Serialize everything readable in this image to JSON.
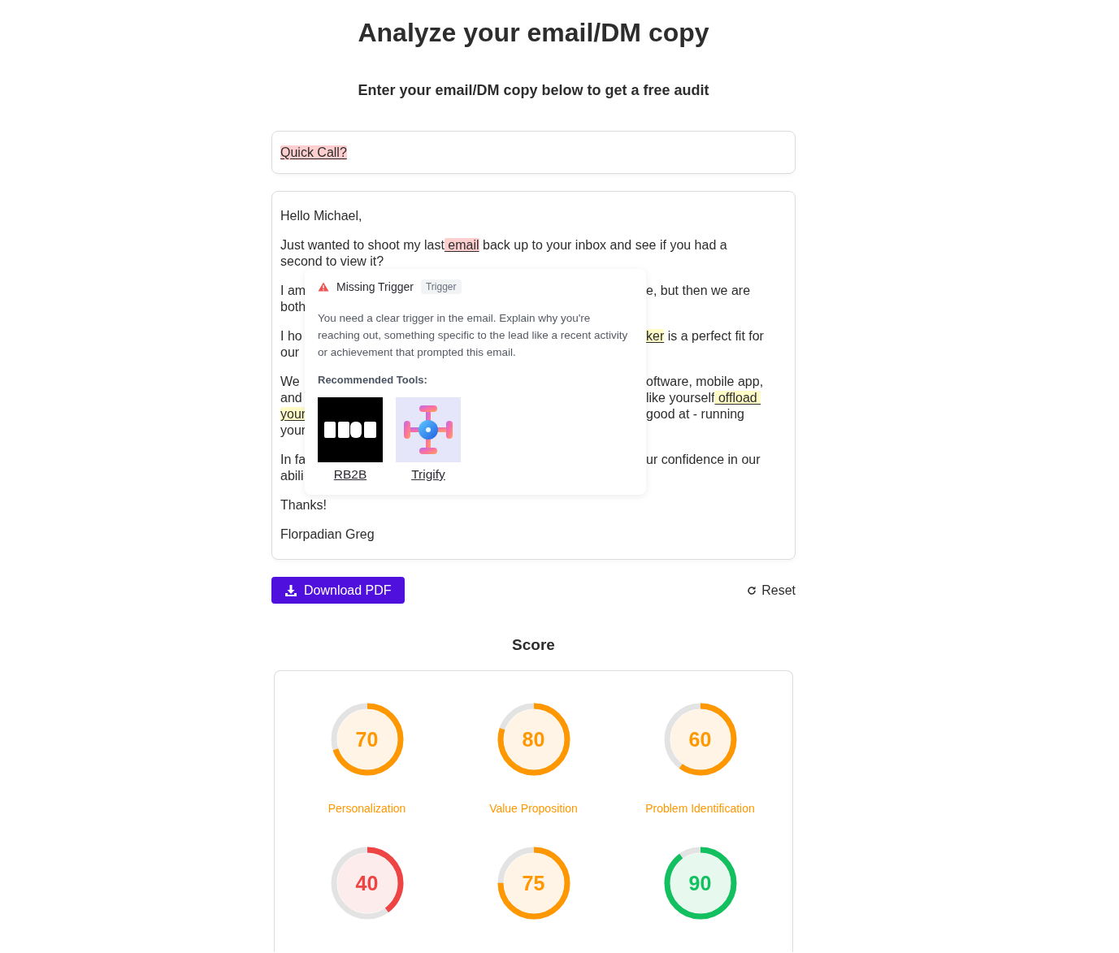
{
  "title": "Analyze your email/DM copy",
  "subtitle": "Enter your email/DM copy below to get a free audit",
  "subject": [
    {
      "text": "Quick Call?",
      "color": "#ffcfcf"
    }
  ],
  "email": {
    "paragraphs": [
      [
        {
          "left": [
            {
              "text": "Hello Michael,"
            }
          ]
        }
      ],
      [
        {
          "left": [
            {
              "text": "Just wanted to shoot my last"
            },
            {
              "text": " email",
              "color": "#ffcfcf"
            },
            {
              "text": " back up to your inbox and see if you had a"
            }
          ]
        },
        {
          "left": [
            {
              "text": "second to view it?"
            }
          ]
        }
      ],
      [
        {
          "left": [
            {
              "text": "I am"
            }
          ],
          "right": [
            {
              "text": "e, but then we are"
            }
          ]
        },
        {
          "left": [
            {
              "text": "both"
            }
          ]
        }
      ],
      [
        {
          "left": [
            {
              "text": "I ho"
            }
          ],
          "right": [
            {
              "text": "ker",
              "color": "#fefbc7"
            },
            {
              "text": " is a perfect fit for"
            }
          ]
        },
        {
          "left": [
            {
              "text": "our"
            }
          ]
        }
      ],
      [
        {
          "left": [
            {
              "text": "We"
            }
          ],
          "right": [
            {
              "text": "oftware, mobile app,"
            }
          ]
        },
        {
          "left": [
            {
              "text": "and"
            }
          ],
          "right": [
            {
              "text": "like yourself"
            },
            {
              "text": " offload ",
              "color": "#fefbc7"
            }
          ]
        },
        {
          "left": [
            {
              "text": "your",
              "color": "#fefbc7"
            }
          ],
          "right": [
            {
              "text": "good at - running"
            }
          ]
        },
        {
          "left": [
            {
              "text": "your"
            }
          ]
        }
      ],
      [
        {
          "left": [
            {
              "text": "In fa"
            }
          ],
          "right": [
            {
              "text": "ur confidence in our"
            }
          ]
        },
        {
          "left": [
            {
              "text": "abili"
            }
          ]
        }
      ],
      [
        {
          "left": [
            {
              "text": "Thanks!"
            }
          ]
        }
      ],
      [
        {
          "left": [
            {
              "text": "Florpadian Greg"
            }
          ]
        }
      ]
    ]
  },
  "popover": {
    "title": "Missing Trigger",
    "tag": "Trigger",
    "description": "You need a clear trigger in the email. Explain why you're reaching out, something specific to the lead like a recent activity or achievement that prompted this email.",
    "tools_heading": "Recommended Tools:",
    "tools": [
      {
        "name": "RB2B",
        "kind": "monogram"
      },
      {
        "name": "Trigify",
        "kind": "cross"
      }
    ]
  },
  "actions": {
    "download": "Download PDF",
    "reset": "Reset"
  },
  "score_heading": "Score",
  "scores": [
    {
      "value": "70",
      "label": "Personalization",
      "level": 0.7,
      "color": "#ff9800"
    },
    {
      "value": "80",
      "label": "Value Proposition",
      "level": 0.8,
      "color": "#ff9800"
    },
    {
      "value": "60",
      "label": "Problem Identification",
      "level": 0.6,
      "color": "#ff9800"
    },
    {
      "value": "40",
      "level": 0.4,
      "color": "#ef4444"
    },
    {
      "value": "75",
      "level": 0.75,
      "color": "#ff9800"
    },
    {
      "value": "90",
      "level": 0.9,
      "color": "#12c060"
    }
  ]
}
